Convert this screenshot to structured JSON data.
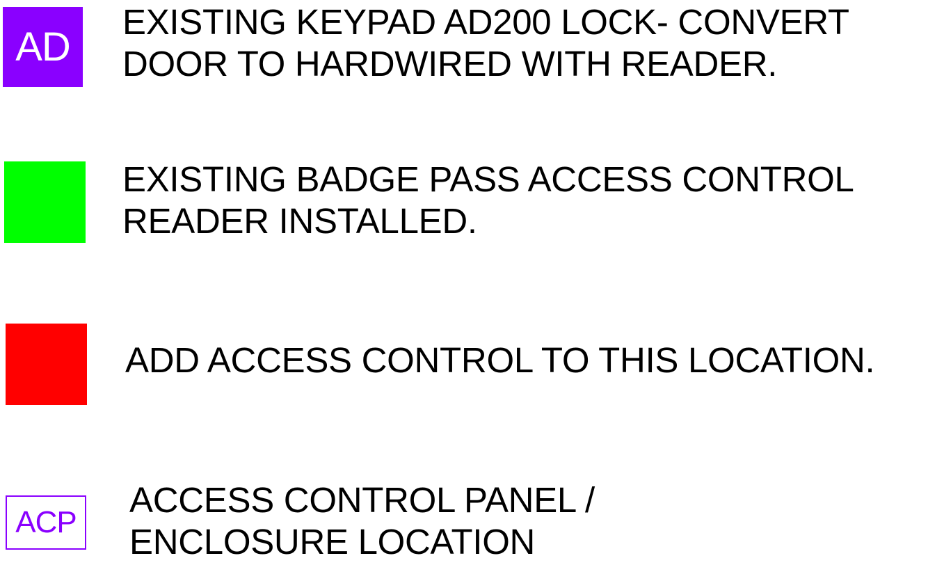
{
  "legend": [
    {
      "symbol_label": "AD",
      "symbol_color": "#8a00ff",
      "line1": "EXISTING KEYPAD AD200 LOCK- CONVERT",
      "line2": "DOOR TO HARDWIRED WITH READER."
    },
    {
      "symbol_label": "",
      "symbol_color": "#00ff00",
      "line1": "EXISTING BADGE PASS ACCESS CONTROL",
      "line2": "READER INSTALLED."
    },
    {
      "symbol_label": "",
      "symbol_color": "#ff0000",
      "line1": "ADD ACCESS CONTROL TO THIS LOCATION.",
      "line2": ""
    },
    {
      "symbol_label": "ACP",
      "symbol_color": "#8a00ff",
      "line1": "ACCESS CONTROL PANEL /",
      "line2": "ENCLOSURE LOCATION"
    }
  ]
}
